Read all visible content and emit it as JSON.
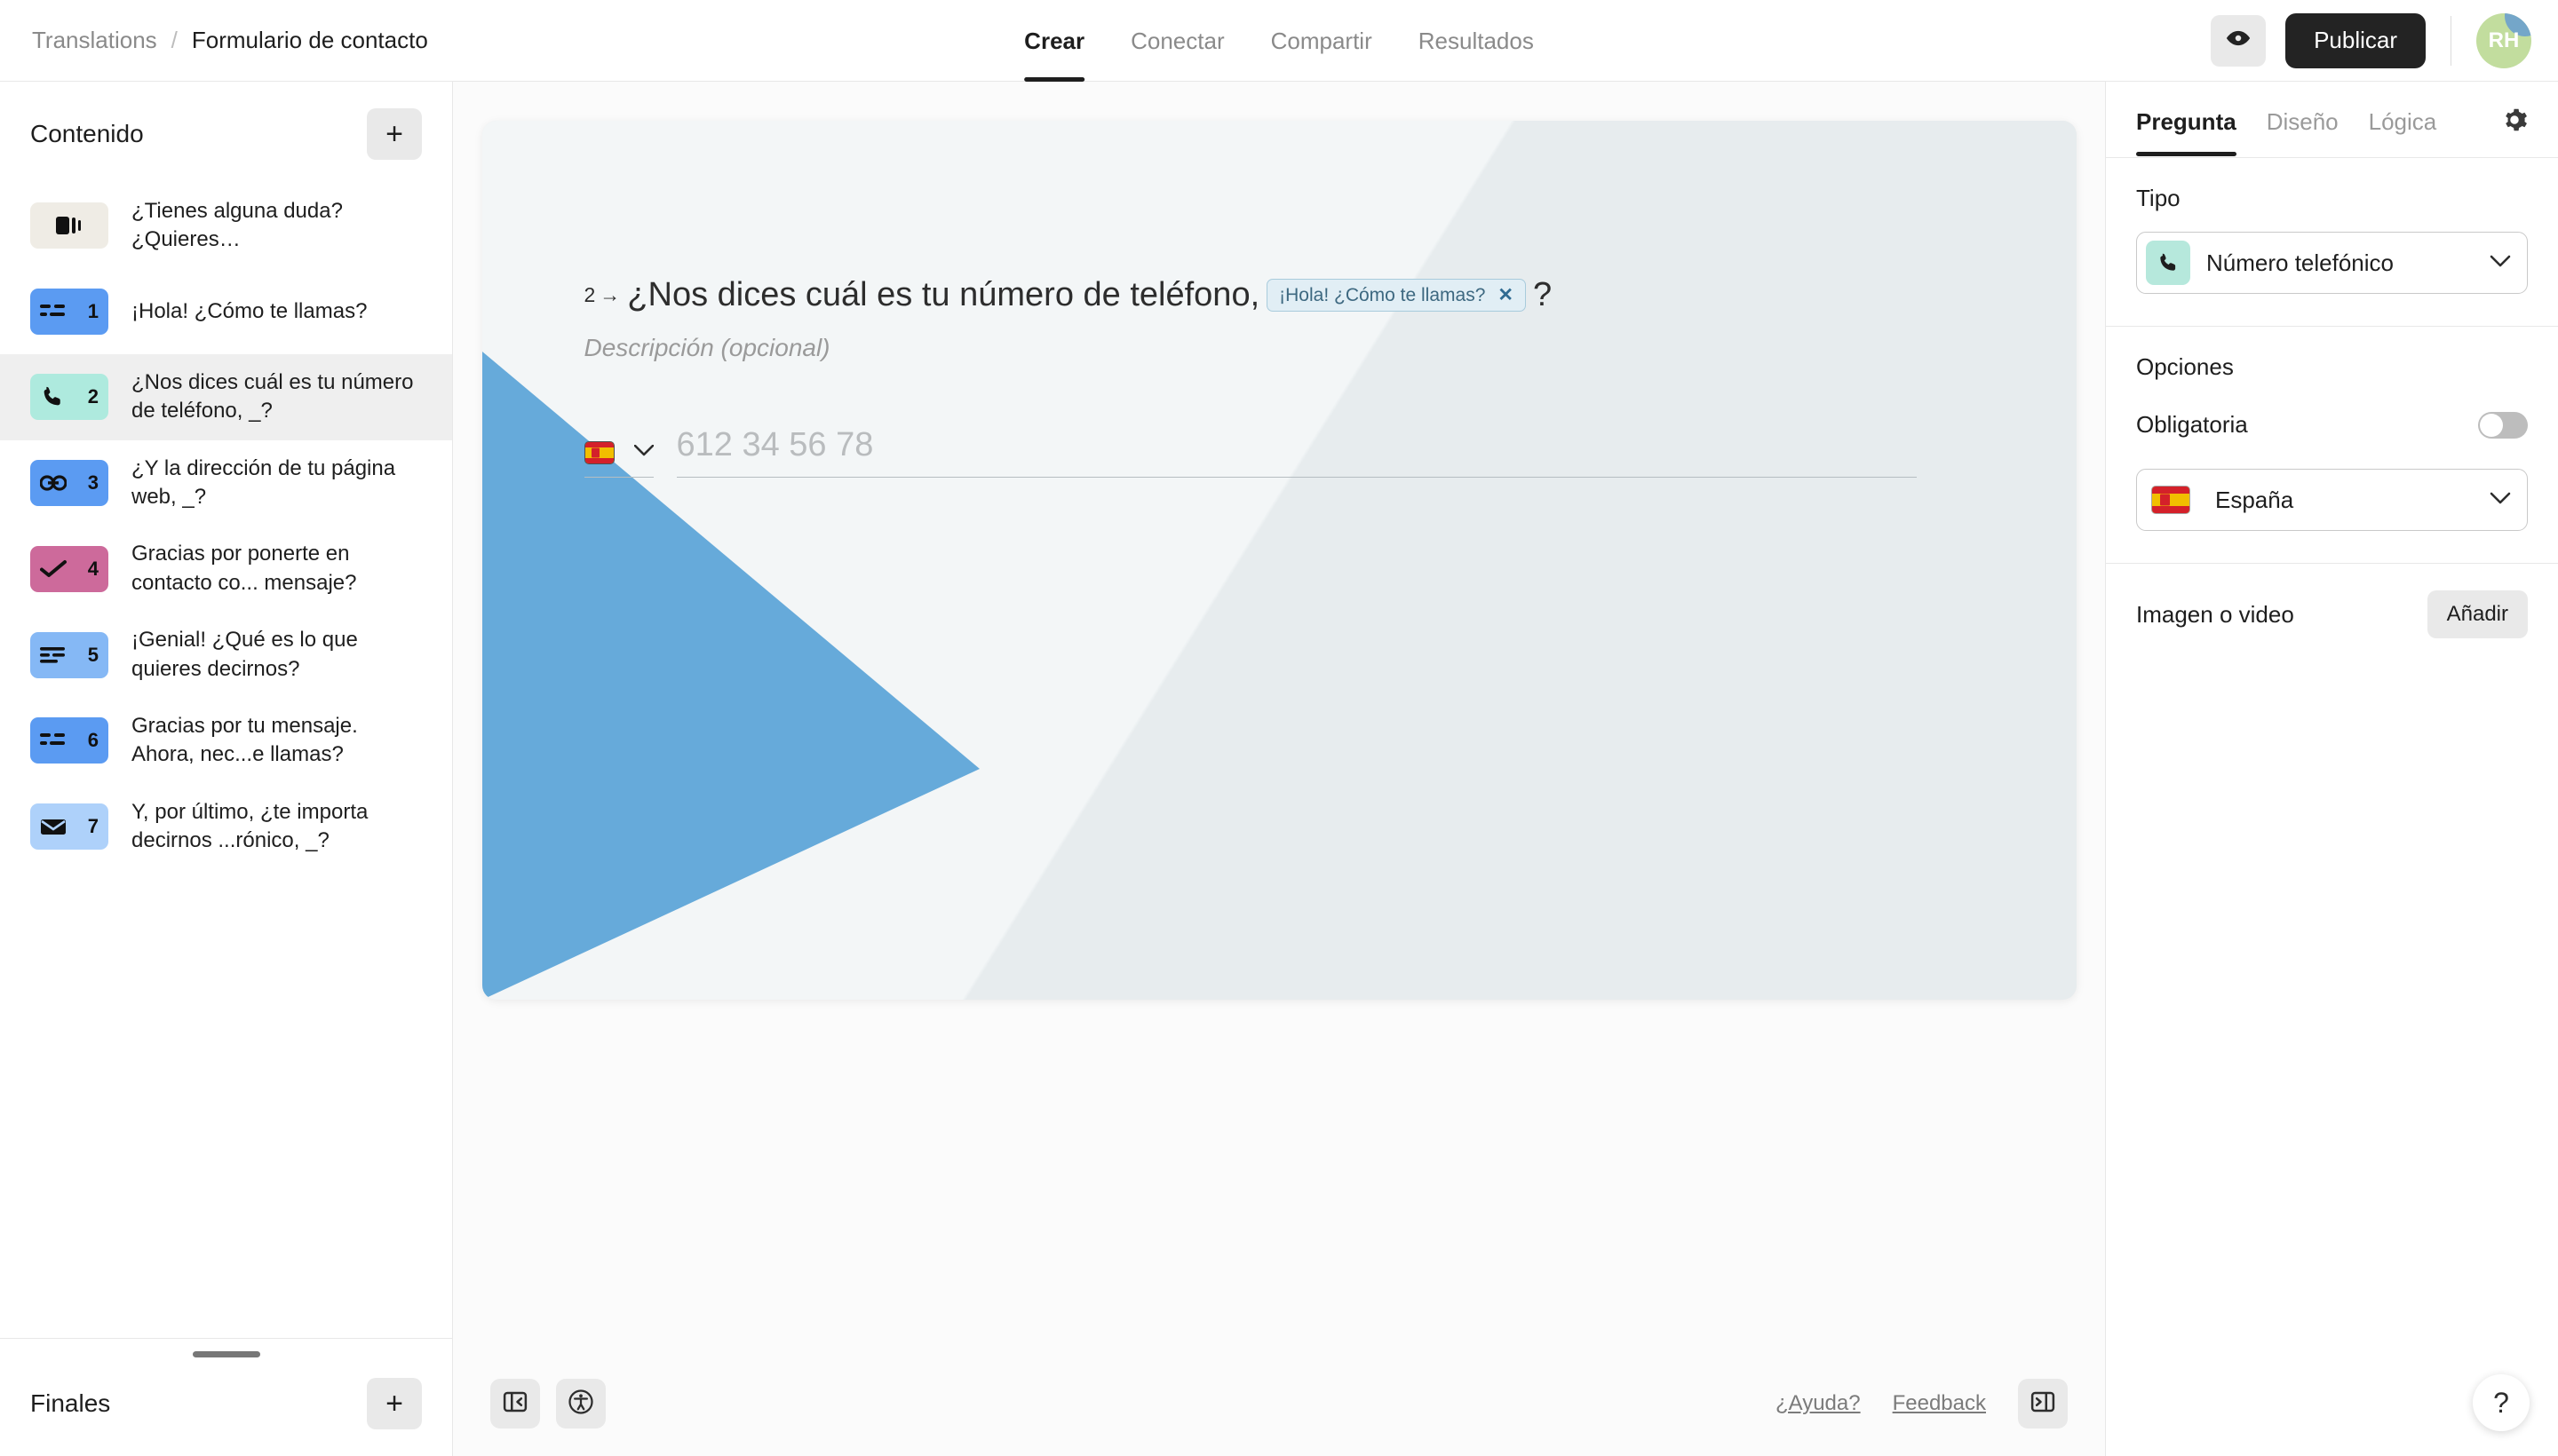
{
  "header": {
    "breadcrumb_root": "Translations",
    "breadcrumb_sep": "/",
    "breadcrumb_current": "Formulario de contacto",
    "tabs": [
      {
        "label": "Crear",
        "active": true
      },
      {
        "label": "Conectar",
        "active": false
      },
      {
        "label": "Compartir",
        "active": false
      },
      {
        "label": "Resultados",
        "active": false
      }
    ],
    "preview_icon": "eye-icon",
    "publish_label": "Publicar",
    "avatar_initials": "RH"
  },
  "sidebar": {
    "title": "Contenido",
    "add_label": "+",
    "items": [
      {
        "num": "",
        "icon": "welcome-screen-icon",
        "color": "#efece5",
        "label": "¿Tienes alguna duda? ¿Quieres…",
        "selected": false
      },
      {
        "num": "1",
        "icon": "short-text-icon",
        "color": "#5b9bf2",
        "label": "¡Hola! ¿Cómo te llamas?",
        "selected": false
      },
      {
        "num": "2",
        "icon": "phone-icon",
        "color": "#aeeade",
        "label": "¿Nos dices cuál es tu número de teléfono, _?",
        "selected": true
      },
      {
        "num": "3",
        "icon": "link-icon",
        "color": "#5b9bf2",
        "label": "¿Y la dirección de tu página web, _?",
        "selected": false
      },
      {
        "num": "4",
        "icon": "check-icon",
        "color": "#cd6a9b",
        "label": "Gracias por ponerte en contacto co... mensaje?",
        "selected": false
      },
      {
        "num": "5",
        "icon": "long-text-icon",
        "color": "#85b8f5",
        "label": "¡Genial! ¿Qué es lo que quieres decirnos?",
        "selected": false
      },
      {
        "num": "6",
        "icon": "short-text-icon",
        "color": "#5b9bf2",
        "label": "Gracias por tu mensaje. Ahora, nec...e llamas?",
        "selected": false
      },
      {
        "num": "7",
        "icon": "email-icon",
        "color": "#aed1fa",
        "label": "Y, por último, ¿te importa decirnos ...rónico, _?",
        "selected": false
      }
    ],
    "footer_title": "Finales",
    "footer_add_label": "+"
  },
  "canvas": {
    "question_number": "2",
    "question_arrow": "→",
    "question_text": "¿Nos dices cuál es tu número de teléfono,",
    "recall_tag": "¡Hola! ¿Cómo te llamas?",
    "recall_tag_remove": "✕",
    "question_suffix": "?",
    "description_placeholder": "Descripción (opcional)",
    "country_flag": "spain-flag-icon",
    "phone_placeholder": "612 34 56 78",
    "accent_color": "#66aada",
    "bg_color": "#eef2f3"
  },
  "bottombar": {
    "collapse_left_icon": "panel-collapse-left-icon",
    "accessibility_icon": "accessibility-icon",
    "help_link": "¿Ayuda?",
    "feedback_link": "Feedback",
    "collapse_right_icon": "panel-collapse-right-icon"
  },
  "rightpanel": {
    "tabs": [
      {
        "label": "Pregunta",
        "active": true
      },
      {
        "label": "Diseño",
        "active": false
      },
      {
        "label": "Lógica",
        "active": false
      }
    ],
    "settings_icon": "gear-icon",
    "type_label": "Tipo",
    "type_value": "Número telefónico",
    "type_icon": "phone-icon",
    "options_label": "Opciones",
    "required_label": "Obligatoria",
    "required_on": false,
    "country_value": "España",
    "country_icon": "spain-flag-icon",
    "media_label": "Imagen o video",
    "media_add_label": "Añadir",
    "help_fab_label": "?"
  }
}
